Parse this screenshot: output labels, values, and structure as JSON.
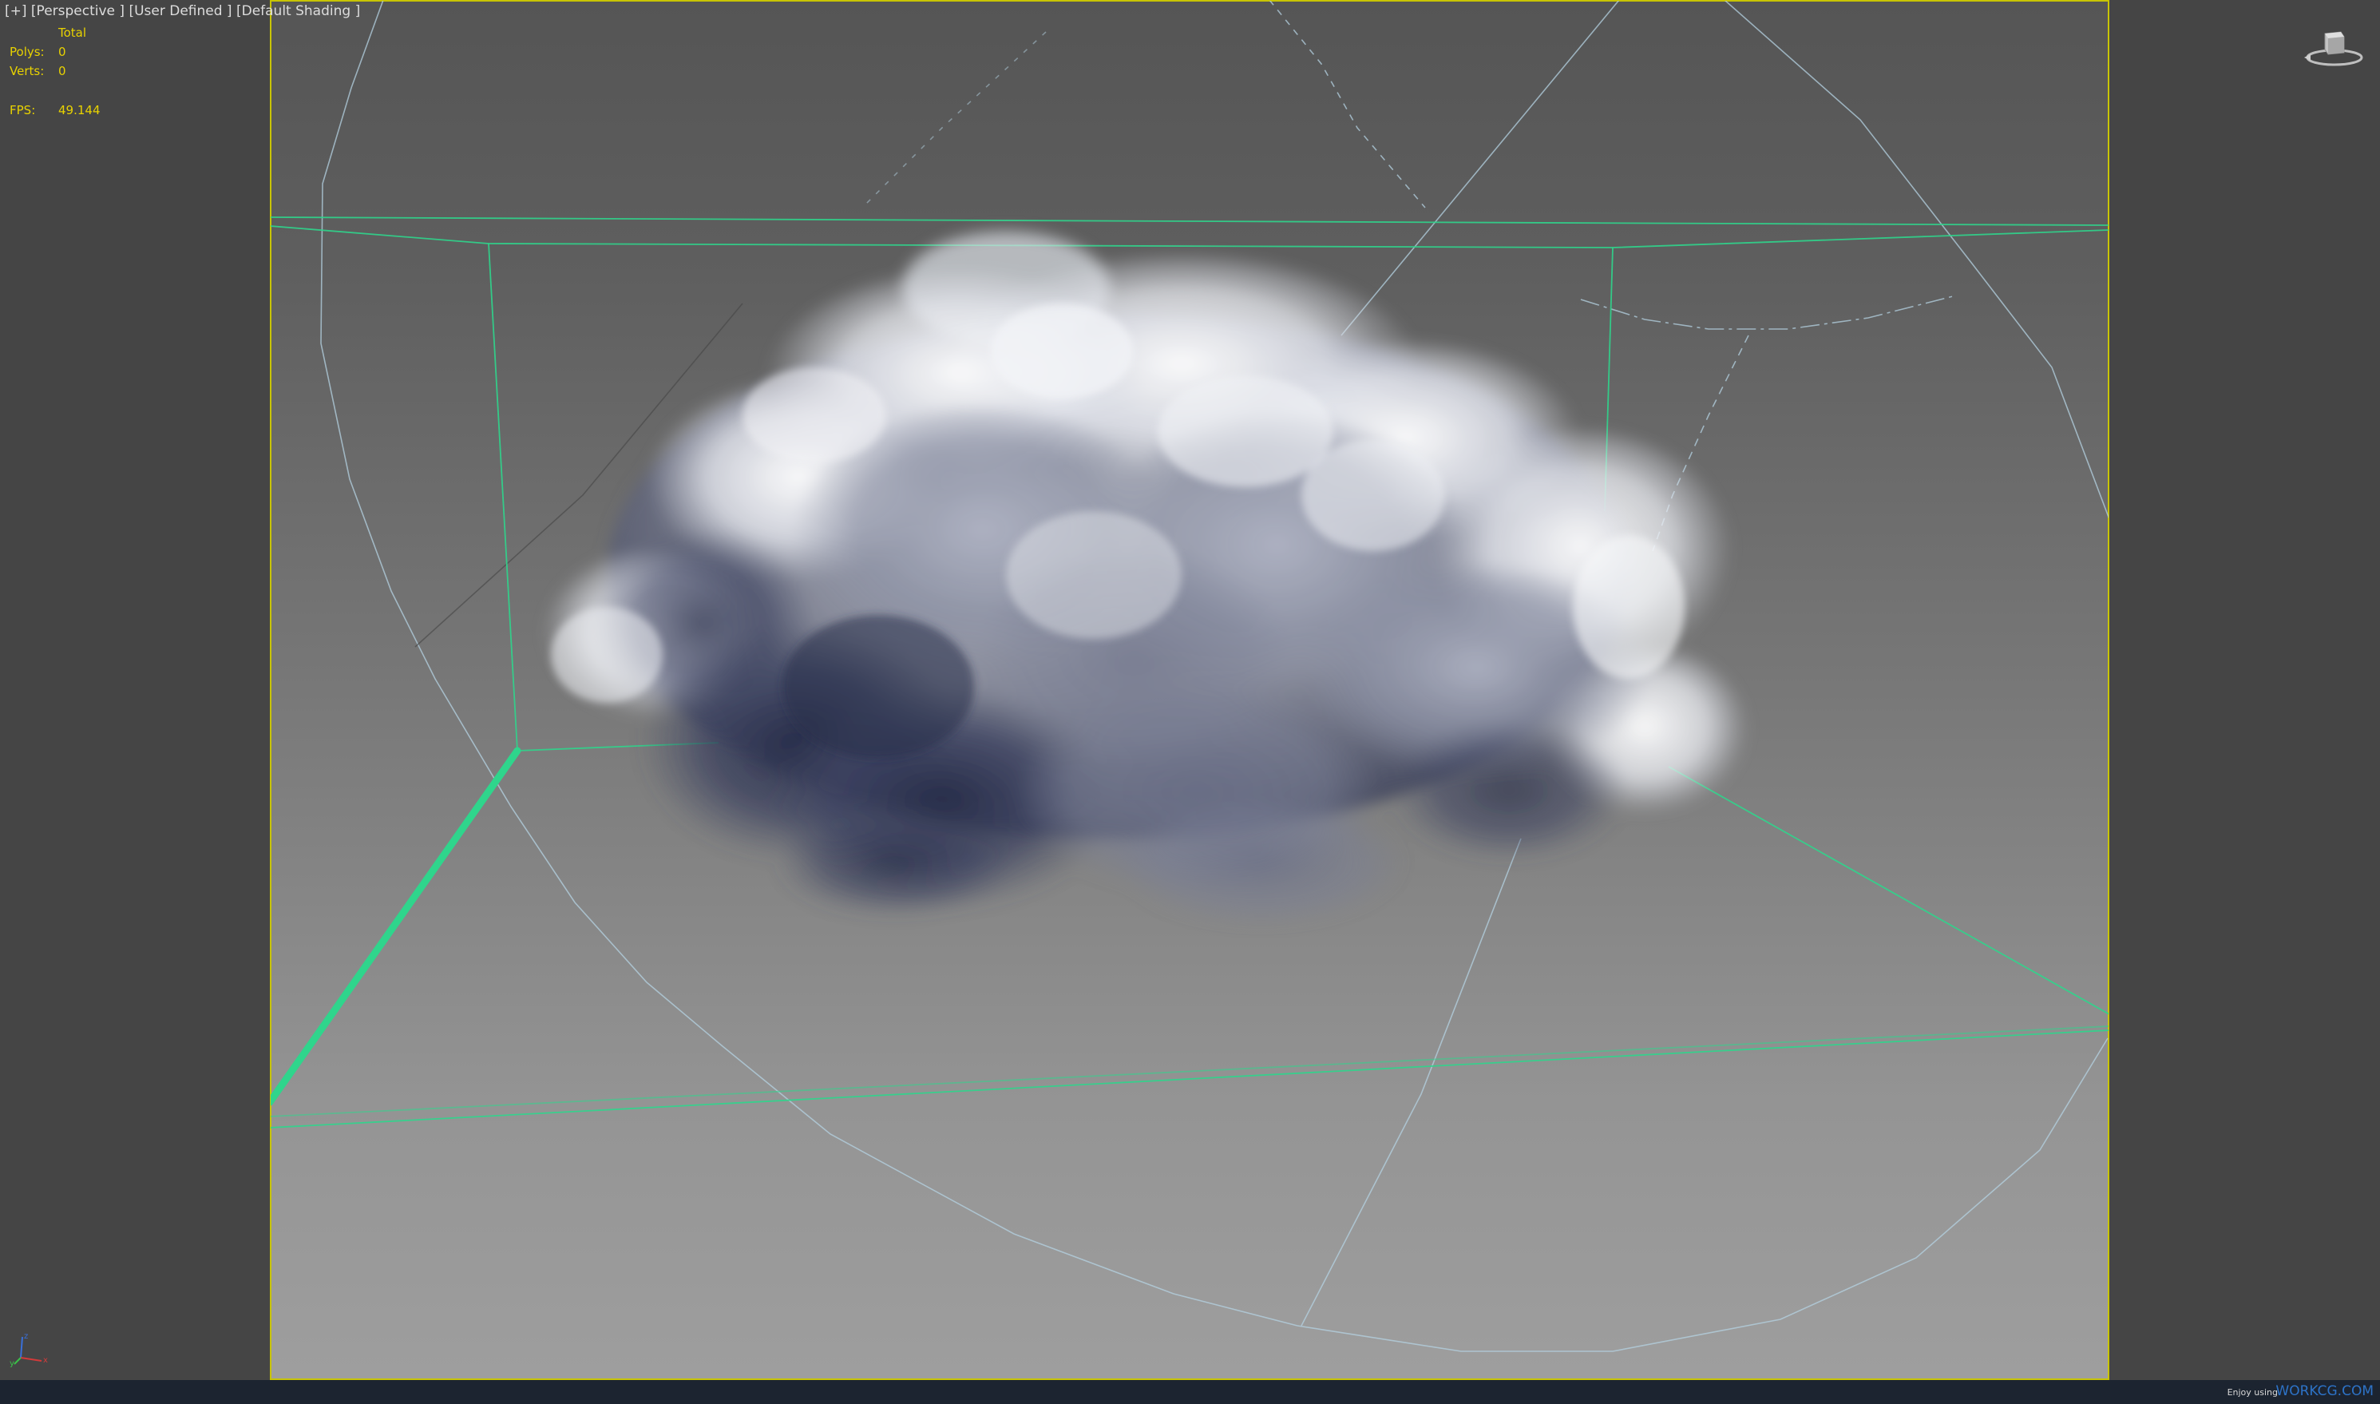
{
  "viewport": {
    "label_plus": "[+]",
    "label_view": "[Perspective ]",
    "label_camera": "[User Defined ]",
    "label_shading": "[Default Shading ]"
  },
  "stats": {
    "total_label": "Total",
    "polys_label": "Polys:",
    "polys_value": "0",
    "verts_label": "Verts:",
    "verts_value": "0",
    "fps_label": "FPS:",
    "fps_value": "49.144"
  },
  "status_bar": {
    "enjoy_text": "Enjoy using",
    "brand_text": "WORKCG.COM"
  },
  "colors": {
    "stats_text": "#e8d200",
    "safe_frame_border": "#c8c400",
    "gizmo_green": "#2fd58c",
    "sphere_line": "#b4d2e2",
    "brand": "#2d73c8"
  },
  "icons": {
    "viewcube": "viewcube-icon",
    "axis_tripod": "axis-tripod-icon"
  }
}
